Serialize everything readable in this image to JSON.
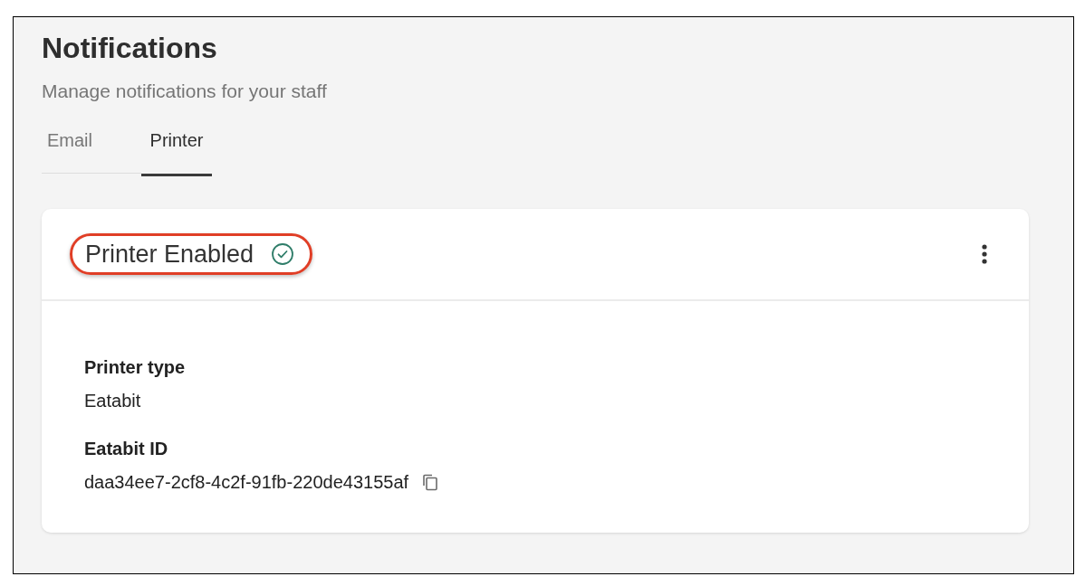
{
  "page": {
    "title": "Notifications",
    "subtitle": "Manage notifications for your staff"
  },
  "tabs": [
    {
      "label": "Email",
      "selected": false
    },
    {
      "label": "Printer",
      "selected": true
    }
  ],
  "card": {
    "status": {
      "label": "Printer Enabled",
      "enabled": true,
      "highlighted": true
    },
    "fields": [
      {
        "label": "Printer type",
        "value": "Eatabit",
        "copyable": false
      },
      {
        "label": "Eatabit ID",
        "value": "daa34ee7-2cf8-4c2f-91fb-220de43155af",
        "copyable": true
      }
    ]
  }
}
